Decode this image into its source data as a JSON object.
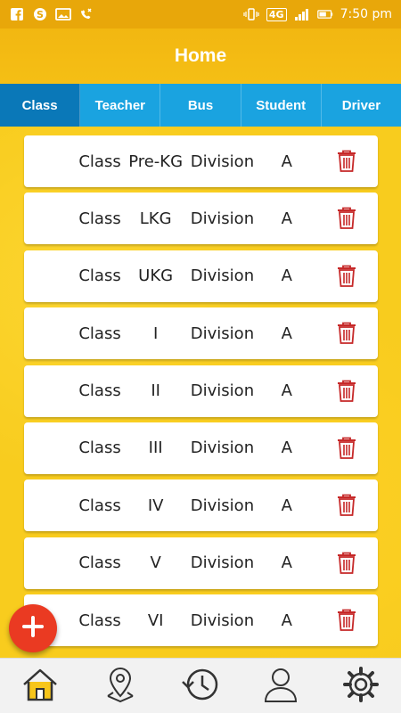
{
  "status_bar": {
    "time": "7:50 pm",
    "network": "4G",
    "left_icons": [
      "facebook-icon",
      "skype-icon",
      "image-icon",
      "missed-call-icon"
    ],
    "right_icons": [
      "vibrate-icon",
      "network-4g-icon",
      "signal-icon",
      "battery-icon"
    ]
  },
  "header": {
    "title": "Home"
  },
  "tabs": [
    {
      "label": "Class",
      "active": true
    },
    {
      "label": "Teacher",
      "active": false
    },
    {
      "label": "Bus",
      "active": false
    },
    {
      "label": "Student",
      "active": false
    },
    {
      "label": "Driver",
      "active": false
    }
  ],
  "class_list": [
    {
      "class_label": "Class",
      "name": "Pre-KG",
      "division_label": "Division",
      "division": "A"
    },
    {
      "class_label": "Class",
      "name": "LKG",
      "division_label": "Division",
      "division": "A"
    },
    {
      "class_label": "Class",
      "name": "UKG",
      "division_label": "Division",
      "division": "A"
    },
    {
      "class_label": "Class",
      "name": "I",
      "division_label": "Division",
      "division": "A"
    },
    {
      "class_label": "Class",
      "name": "II",
      "division_label": "Division",
      "division": "A"
    },
    {
      "class_label": "Class",
      "name": "III",
      "division_label": "Division",
      "division": "A"
    },
    {
      "class_label": "Class",
      "name": "IV",
      "division_label": "Division",
      "division": "A"
    },
    {
      "class_label": "Class",
      "name": "V",
      "division_label": "Division",
      "division": "A"
    },
    {
      "class_label": "Class",
      "name": "VI",
      "division_label": "Division",
      "division": "A"
    }
  ],
  "colors": {
    "accent": "#f7c51a",
    "tab_bar": "#1aa3e0",
    "tab_active": "#0a78b8",
    "delete_icon": "#c62828",
    "fab": "#ea3a22"
  },
  "bottom_nav": [
    {
      "icon": "home-icon",
      "active": true
    },
    {
      "icon": "location-pin-icon",
      "active": false
    },
    {
      "icon": "history-icon",
      "active": false
    },
    {
      "icon": "profile-icon",
      "active": false
    },
    {
      "icon": "settings-gear-icon",
      "active": false
    }
  ]
}
